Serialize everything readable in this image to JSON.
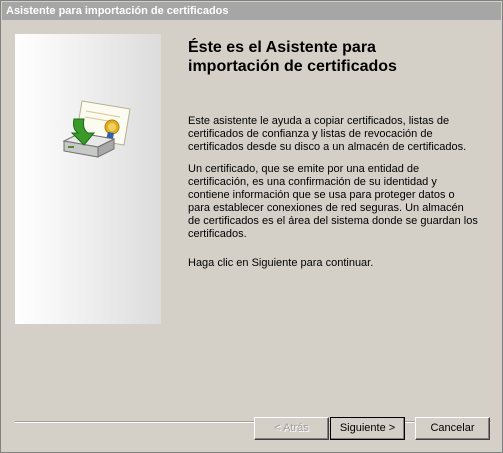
{
  "window": {
    "title": "Asistente para importación de certificados"
  },
  "content": {
    "heading": "Éste es el Asistente para importación de certificados",
    "paragraph1": "Este asistente le ayuda a copiar certificados, listas de certificados de confianza y listas de revocación de certificados desde su disco a un almacén de certificados.",
    "paragraph2": "Un certificado, que se emite por una entidad de certificación, es una confirmación de su identidad y contiene información que se usa para proteger datos o para establecer conexiones de red seguras. Un almacén de certificados es el área del sistema donde se guardan los certificados.",
    "paragraph3": "Haga clic en Siguiente para continuar."
  },
  "buttons": {
    "back_label": "< Atrás",
    "next_label": "Siguiente >",
    "cancel_label": "Cancelar",
    "back_enabled": false
  },
  "icons": {
    "wizard_art": "certificate-import-icon",
    "close": "close-icon"
  },
  "colors": {
    "titlebar_inactive": "#a6a6a6",
    "dialog_face": "#d4d0c8",
    "arrow_green": "#3a9a2a",
    "ribbon_blue": "#2f5fb0",
    "seal_gold": "#e0b020"
  }
}
